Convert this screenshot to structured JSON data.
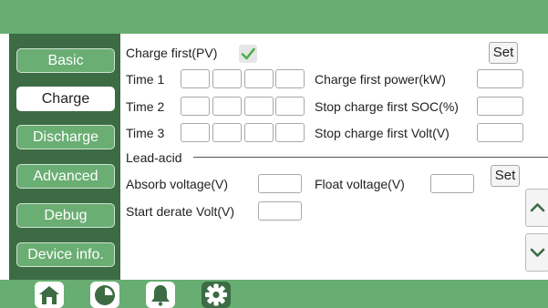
{
  "sidebar": {
    "items": [
      {
        "label": "Basic",
        "active": false
      },
      {
        "label": "Charge",
        "active": true
      },
      {
        "label": "Discharge",
        "active": false
      },
      {
        "label": "Advanced",
        "active": false
      },
      {
        "label": "Debug",
        "active": false
      },
      {
        "label": "Device info.",
        "active": false
      }
    ]
  },
  "charge": {
    "charge_first_label": "Charge first(PV)",
    "charge_first_checked": true,
    "set_label": "Set",
    "time1_label": "Time 1",
    "time2_label": "Time 2",
    "time3_label": "Time 3",
    "charge_power_label": "Charge first power(kW)",
    "stop_soc_label": "Stop charge first SOC(%)",
    "stop_volt_label": "Stop charge first Volt(V)"
  },
  "lead_acid": {
    "section_label": "Lead-acid",
    "absorb_label": "Absorb voltage(V)",
    "float_label": "Float voltage(V)",
    "derate_label": "Start derate Volt(V)",
    "set_label": "Set"
  },
  "bottom_tabs": [
    {
      "icon": "home-icon",
      "active": false
    },
    {
      "icon": "pie-chart-icon",
      "active": false
    },
    {
      "icon": "bell-icon",
      "active": false
    },
    {
      "icon": "gear-icon",
      "active": true
    }
  ],
  "colors": {
    "bar_green": "#68ad72",
    "sidebar_dark": "#3c6b44",
    "check_green": "#4caf50"
  }
}
